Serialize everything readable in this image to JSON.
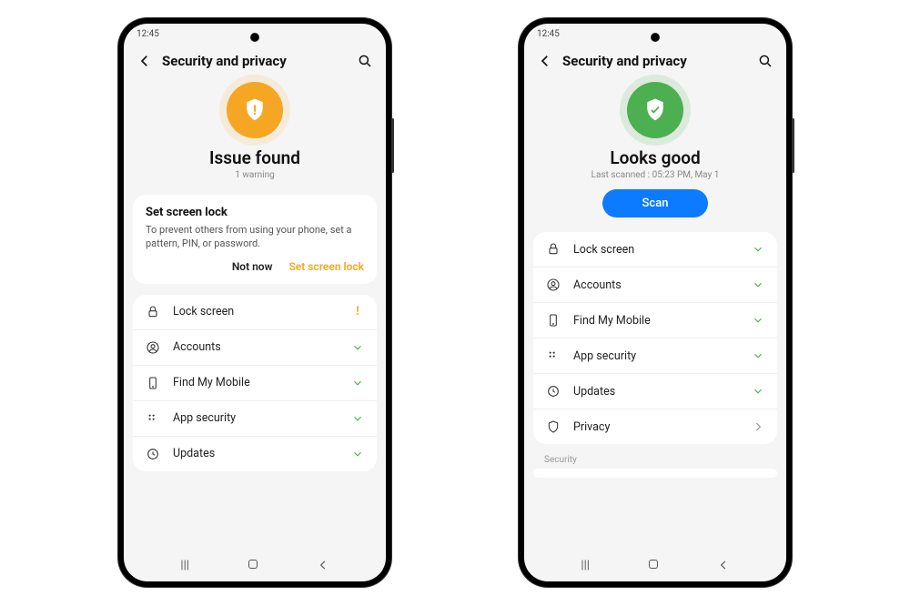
{
  "left": {
    "status_bar_time": "12:45",
    "header_title": "Security and privacy",
    "hero": {
      "title": "Issue found",
      "subtitle": "1 warning"
    },
    "card": {
      "title": "Set screen lock",
      "body": "To prevent others from using your phone, set a pattern, PIN, or password.",
      "secondary": "Not now",
      "primary": "Set screen lock"
    },
    "rows": [
      {
        "label": "Lock screen",
        "status": "warn"
      },
      {
        "label": "Accounts",
        "status": "ok"
      },
      {
        "label": "Find My Mobile",
        "status": "ok"
      },
      {
        "label": "App security",
        "status": "ok"
      },
      {
        "label": "Updates",
        "status": "ok"
      }
    ]
  },
  "right": {
    "status_bar_time": "12:45",
    "header_title": "Security and privacy",
    "hero": {
      "title": "Looks good",
      "subtitle": "Last scanned : 05:23 PM, May 1",
      "scan_label": "Scan"
    },
    "rows": [
      {
        "label": "Lock screen",
        "status": "ok"
      },
      {
        "label": "Accounts",
        "status": "ok"
      },
      {
        "label": "Find My Mobile",
        "status": "ok"
      },
      {
        "label": "App security",
        "status": "ok"
      },
      {
        "label": "Updates",
        "status": "ok"
      },
      {
        "label": "Privacy",
        "status": "chev"
      }
    ],
    "section_label": "Security"
  }
}
